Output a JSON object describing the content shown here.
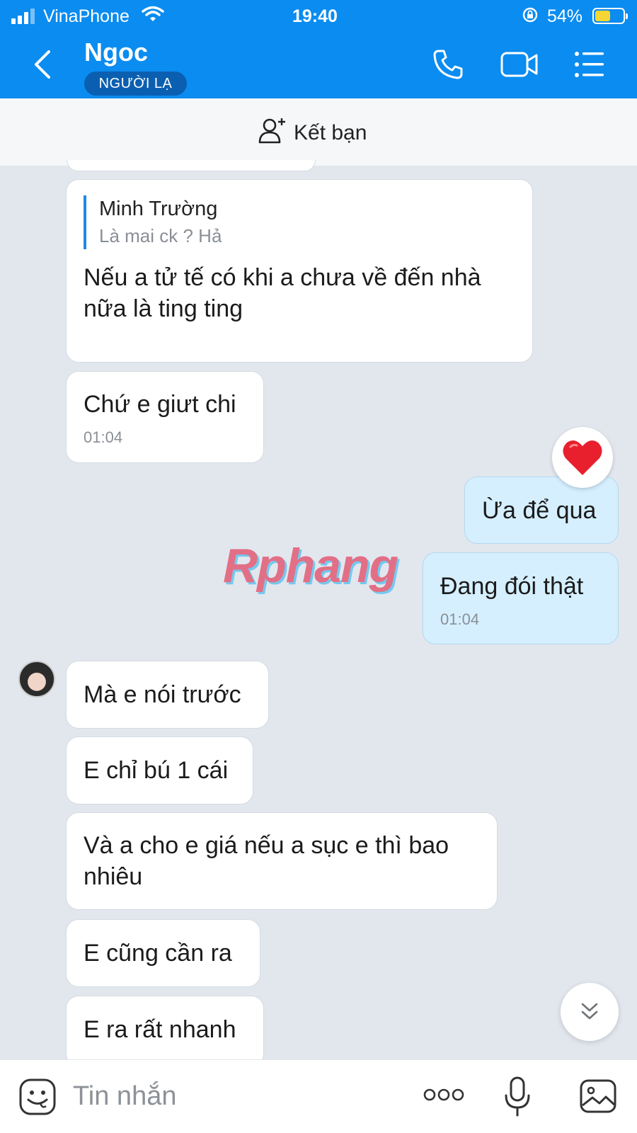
{
  "status_bar": {
    "carrier": "VinaPhone",
    "time": "19:40",
    "battery_percent": "54%",
    "battery_level": 0.54,
    "battery_color": "#f6d634"
  },
  "header": {
    "contact_name": "Ngoc",
    "badge": "NGƯỜI LẠ",
    "background_color": "#0a8cf0",
    "icons": [
      "back-icon",
      "phone-icon",
      "video-call-icon",
      "menu-icon"
    ]
  },
  "friend_bar": {
    "label": "Kết bạn",
    "icon": "add-friend-icon"
  },
  "messages": [
    {
      "direction": "incoming",
      "quote_author": "Minh Trường",
      "quote_text": "Là mai ck ? Hả",
      "text": "Nếu a tử tế có khi a chưa về đến nhà nữa là ting ting"
    },
    {
      "direction": "incoming",
      "text": "Chứ e giưt chi",
      "time": "01:04"
    },
    {
      "direction": "outgoing",
      "text": "Ừa để qua",
      "reaction": "heart-icon"
    },
    {
      "direction": "outgoing",
      "text": "Đang đói thật",
      "time": "01:04"
    },
    {
      "direction": "incoming",
      "text": "Mà e nói trước"
    },
    {
      "direction": "incoming",
      "text": "E chỉ bú 1 cái"
    },
    {
      "direction": "incoming",
      "text": "Và a cho e giá nếu a sục e thì bao nhiêu"
    },
    {
      "direction": "incoming",
      "text": "E cũng cần ra"
    },
    {
      "direction": "incoming",
      "text": "E ra rất nhanh"
    }
  ],
  "watermark": "Rphang",
  "input_bar": {
    "placeholder": "Tin nhắn",
    "icons": [
      "sticker-icon",
      "more-icon",
      "microphone-icon",
      "image-icon"
    ]
  },
  "colors": {
    "incoming_bubble": "#ffffff",
    "outgoing_bubble": "#d5efff",
    "chat_background": "#e2e7ee"
  }
}
